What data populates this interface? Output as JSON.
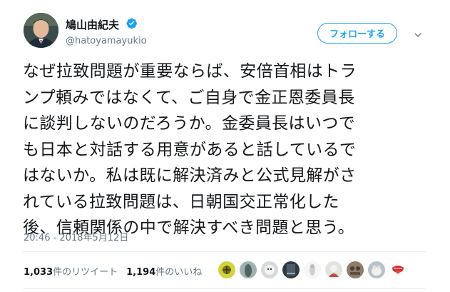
{
  "author": {
    "display_name": "鳩山由紀夫",
    "handle": "@hatoyamayukio",
    "verified_icon": "verified-badge-icon"
  },
  "follow_button": {
    "label": "フォローする"
  },
  "menu": {
    "icon": "chevron-down-icon"
  },
  "tweet": {
    "lines": [
      "なぜ拉致問題が重要ならば、安倍首相はトラ",
      "ンプ頼みではなくて、ご自身で金正恩委員長",
      "に談判しないのだろうか。金委員長はいつで",
      "も日本と対話する用意があると話しているで",
      "はないか。私は既に解決済みと公式見解がさ",
      "れている拉致問題は、日朝国交正常化した",
      "後、信頼関係の中で解決すべき問題と思う。"
    ],
    "timestamp": "20:46 - 2018年5月12日"
  },
  "stats": {
    "retweet_count": "1,033",
    "retweet_label": "件のリツイート",
    "like_count": "1,194",
    "like_label": "件のいいね"
  },
  "likers": [
    {
      "color": "#c9c93a"
    },
    {
      "color": "#6f8a86"
    },
    {
      "color": "#bfc4c6"
    },
    {
      "color": "#3b4850"
    },
    {
      "color": "#e8e8e8"
    },
    {
      "color": "#d6dcd2"
    },
    {
      "color": "#7d6f5c"
    },
    {
      "color": "#c8cfd4"
    },
    {
      "color": "#d42b2b"
    }
  ],
  "colors": {
    "accent": "#1da1f2",
    "text": "#14171a",
    "muted": "#657786"
  }
}
